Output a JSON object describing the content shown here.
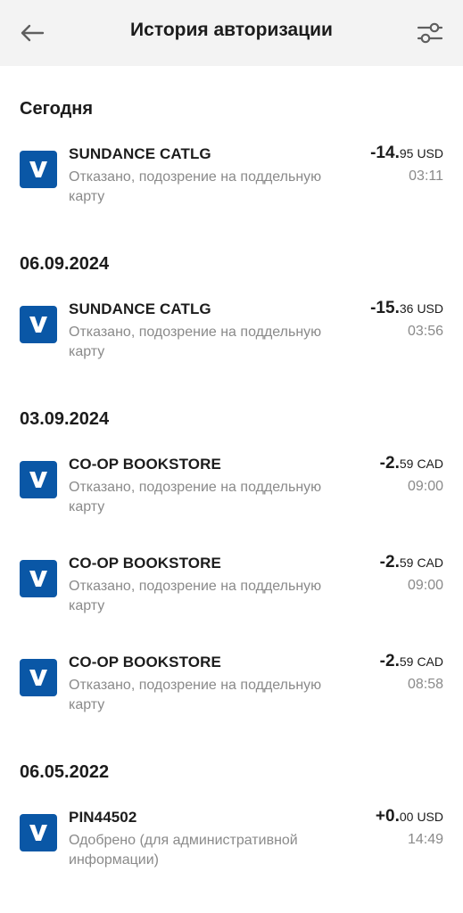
{
  "header": {
    "title": "История авторизации",
    "back_icon": "arrow-left-icon",
    "filter_icon": "sliders-icon"
  },
  "colors": {
    "logo_bg": "#0a57a6",
    "header_bg": "#f3f3f3"
  },
  "sections": [
    {
      "date": "Сегодня",
      "items": [
        {
          "merchant": "SUNDANCE CATLG",
          "status": "Отказано, подозрение на поддельную карту",
          "amount_int": "-14.",
          "amount_dec": "95",
          "currency": "USD",
          "time": "03:11"
        }
      ]
    },
    {
      "date": "06.09.2024",
      "items": [
        {
          "merchant": "SUNDANCE CATLG",
          "status": "Отказано, подозрение на поддельную карту",
          "amount_int": "-15.",
          "amount_dec": "36",
          "currency": "USD",
          "time": "03:56"
        }
      ]
    },
    {
      "date": "03.09.2024",
      "items": [
        {
          "merchant": "CO-OP BOOKSTORE",
          "status": "Отказано, подозрение на поддельную карту",
          "amount_int": "-2.",
          "amount_dec": "59",
          "currency": "CAD",
          "time": "09:00"
        },
        {
          "merchant": "CO-OP BOOKSTORE",
          "status": "Отказано, подозрение на поддельную карту",
          "amount_int": "-2.",
          "amount_dec": "59",
          "currency": "CAD",
          "time": "09:00"
        },
        {
          "merchant": "CO-OP BOOKSTORE",
          "status": "Отказано, подозрение на поддельную карту",
          "amount_int": "-2.",
          "amount_dec": "59",
          "currency": "CAD",
          "time": "08:58"
        }
      ]
    },
    {
      "date": "06.05.2022",
      "items": [
        {
          "merchant": "PIN44502",
          "status": "Одобрено (для административной информации)",
          "amount_int": "+0.",
          "amount_dec": "00",
          "currency": "USD",
          "time": "14:49"
        }
      ]
    }
  ]
}
